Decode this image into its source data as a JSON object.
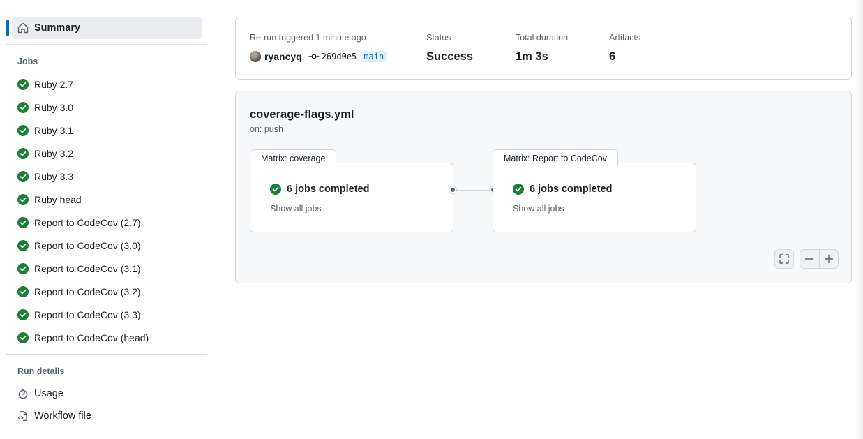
{
  "sidebar": {
    "summary_label": "Summary",
    "jobs_heading": "Jobs",
    "jobs": [
      {
        "label": "Ruby 2.7"
      },
      {
        "label": "Ruby 3.0"
      },
      {
        "label": "Ruby 3.1"
      },
      {
        "label": "Ruby 3.2"
      },
      {
        "label": "Ruby 3.3"
      },
      {
        "label": "Ruby head"
      },
      {
        "label": "Report to CodeCov (2.7)"
      },
      {
        "label": "Report to CodeCov (3.0)"
      },
      {
        "label": "Report to CodeCov (3.1)"
      },
      {
        "label": "Report to CodeCov (3.2)"
      },
      {
        "label": "Report to CodeCov (3.3)"
      },
      {
        "label": "Report to CodeCov (head)"
      }
    ],
    "run_details_heading": "Run details",
    "usage_label": "Usage",
    "workflow_file_label": "Workflow file"
  },
  "run_info": {
    "trigger_text": "Re-run triggered 1 minute ago",
    "user": "ryancyq",
    "commit_sha": "269d0e5",
    "branch": "main",
    "status_label": "Status",
    "status_value": "Success",
    "duration_label": "Total duration",
    "duration_value": "1m 3s",
    "artifacts_label": "Artifacts",
    "artifacts_value": "6"
  },
  "workflow": {
    "file": "coverage-flags.yml",
    "trigger": "on: push",
    "matrices": [
      {
        "tab": "Matrix: coverage",
        "status": "6 jobs completed",
        "link": "Show all jobs"
      },
      {
        "tab": "Matrix: Report to CodeCov",
        "status": "6 jobs completed",
        "link": "Show all jobs"
      }
    ]
  },
  "colors": {
    "success": "#1a7f37",
    "accent": "#0969da"
  },
  "icons": {
    "summary": "home-icon",
    "job_status": "check-circle-fill-icon",
    "usage": "stopwatch-icon",
    "workflow_file": "file-code-icon",
    "commit": "git-commit-icon",
    "fullscreen": "screen-full-icon",
    "zoom_out": "dash-icon",
    "zoom_in": "plus-icon"
  }
}
